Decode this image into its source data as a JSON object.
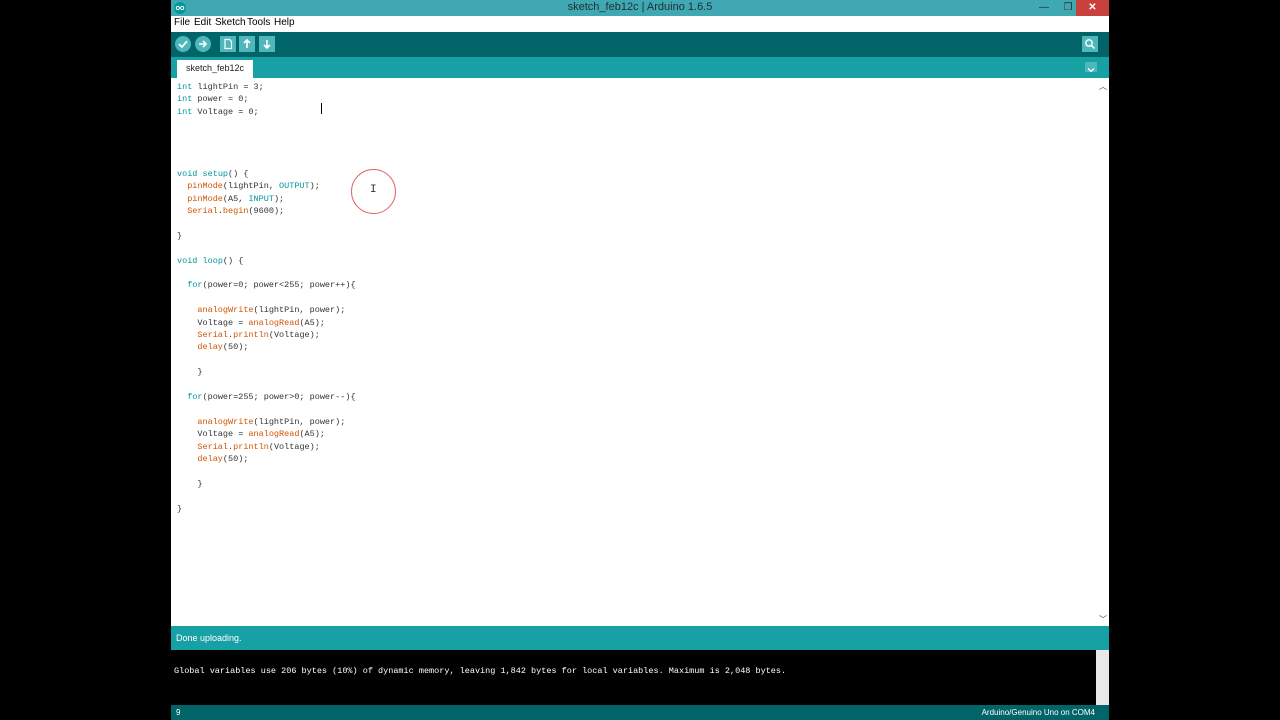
{
  "window": {
    "title": "sketch_feb12c | Arduino 1.6.5"
  },
  "menu": [
    "File",
    "Edit",
    "Sketch",
    "Tools",
    "Help"
  ],
  "toolbar": {
    "buttons": [
      "verify-icon",
      "upload-icon",
      "new-icon",
      "open-icon",
      "save-icon"
    ],
    "serial_monitor": "magnifier-icon"
  },
  "tabs": [
    {
      "label": "sketch_feb12c"
    }
  ],
  "code_lines": [
    "int lightPin = 3;",
    "int power = 0;",
    "int Voltage = 0;",
    "",
    "",
    "",
    "",
    "void setup() {",
    "  pinMode(lightPin, OUTPUT);",
    "  pinMode(A5, INPUT);",
    "  Serial.begin(9600);",
    "",
    "}",
    "",
    "void loop() {",
    "",
    "  for(power=0; power<255; power++){",
    "",
    "    analogWrite(lightPin, power);",
    "    Voltage = analogRead(A5);",
    "    Serial.println(Voltage);",
    "    delay(50);",
    "",
    "    }",
    "",
    "  for(power=255; power>0; power--){",
    "",
    "    analogWrite(lightPin, power);",
    "    Voltage = analogRead(A5);",
    "    Serial.println(Voltage);",
    "    delay(50);",
    "",
    "    }",
    "",
    "}"
  ],
  "status": {
    "text": "Done uploading."
  },
  "console": {
    "line": "Global variables use 206 bytes (10%) of dynamic memory, leaving 1,842 bytes for local variables. Maximum is 2,048 bytes."
  },
  "footer": {
    "line_number": "9",
    "board": "Arduino/Genuino Uno on COM4"
  },
  "colors": {
    "toolbar": "#006468",
    "tabbar": "#17a1a5",
    "keyword": "#00979c",
    "function": "#d35400"
  }
}
